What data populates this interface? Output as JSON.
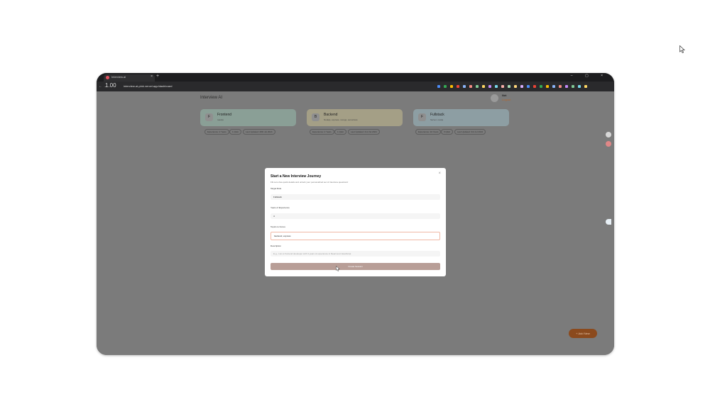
{
  "browser": {
    "tab_title": "Interview.ai",
    "tab_close": "×",
    "new_tab": "+",
    "window_controls": "–  ▢  ×",
    "zoom": "1.00",
    "nav": "← →",
    "url": "interview-ai-pink.vercel.app/dashboard",
    "extension_colors": [
      "#4c8bf5",
      "#34a853",
      "#fbbc05",
      "#ea4335",
      "#8ab4f8",
      "#f28b82",
      "#81c995",
      "#fdd663",
      "#c58af9",
      "#78d9ec",
      "#f6aea9",
      "#a8dab5",
      "#ffd57a",
      "#d7aefb",
      "#4c8bf5",
      "#ea4335",
      "#34a853",
      "#fbbc05",
      "#8ab4f8",
      "#f28b82",
      "#c58af9",
      "#81c995",
      "#78d9ec",
      "#fdd663"
    ]
  },
  "header": {
    "brand": "Interview AI",
    "user_name": "Net",
    "logout": "Logout"
  },
  "cards": [
    {
      "letter": "F",
      "title": "Frontend",
      "subtitle": "reactjs",
      "color": "#8a9f96",
      "chips": [
        "Experience: 2 Years",
        "1 Q&A",
        "Last Updated: 28th Jul 2024"
      ]
    },
    {
      "letter": "B",
      "title": "Backend",
      "subtitle": "Nodejs, express, mongo, serverless",
      "color": "#a49f86",
      "chips": [
        "Experience: 2 Years",
        "1 Q&A",
        "Last Updated: 2nd Jul 2024"
      ]
    },
    {
      "letter": "F",
      "title": "Fullstack",
      "subtitle": "Server, nextjs",
      "color": "#8d9ea3",
      "chips": [
        "Experience: 10 Years",
        "0 Q&A",
        "Last Updated: 3rd Jul 2024"
      ]
    }
  ],
  "add_button": "+ Add New",
  "modal": {
    "title": "Start a New Interview Journey",
    "subtitle": "Fill out a few quick details and unlock your personalized set of interview questions!",
    "close": "×",
    "target_role_label": "Target Role",
    "target_role_value": "Fullstack",
    "experience_label": "Years of Experience",
    "experience_value": "4",
    "topics_label": "Topics to Focus",
    "topics_value": "backend, express",
    "description_label": "Description",
    "description_placeholder": "E.g., I am a frontend developer with 3 years of experience in React and JavaScript",
    "create_button": "Create Session"
  }
}
